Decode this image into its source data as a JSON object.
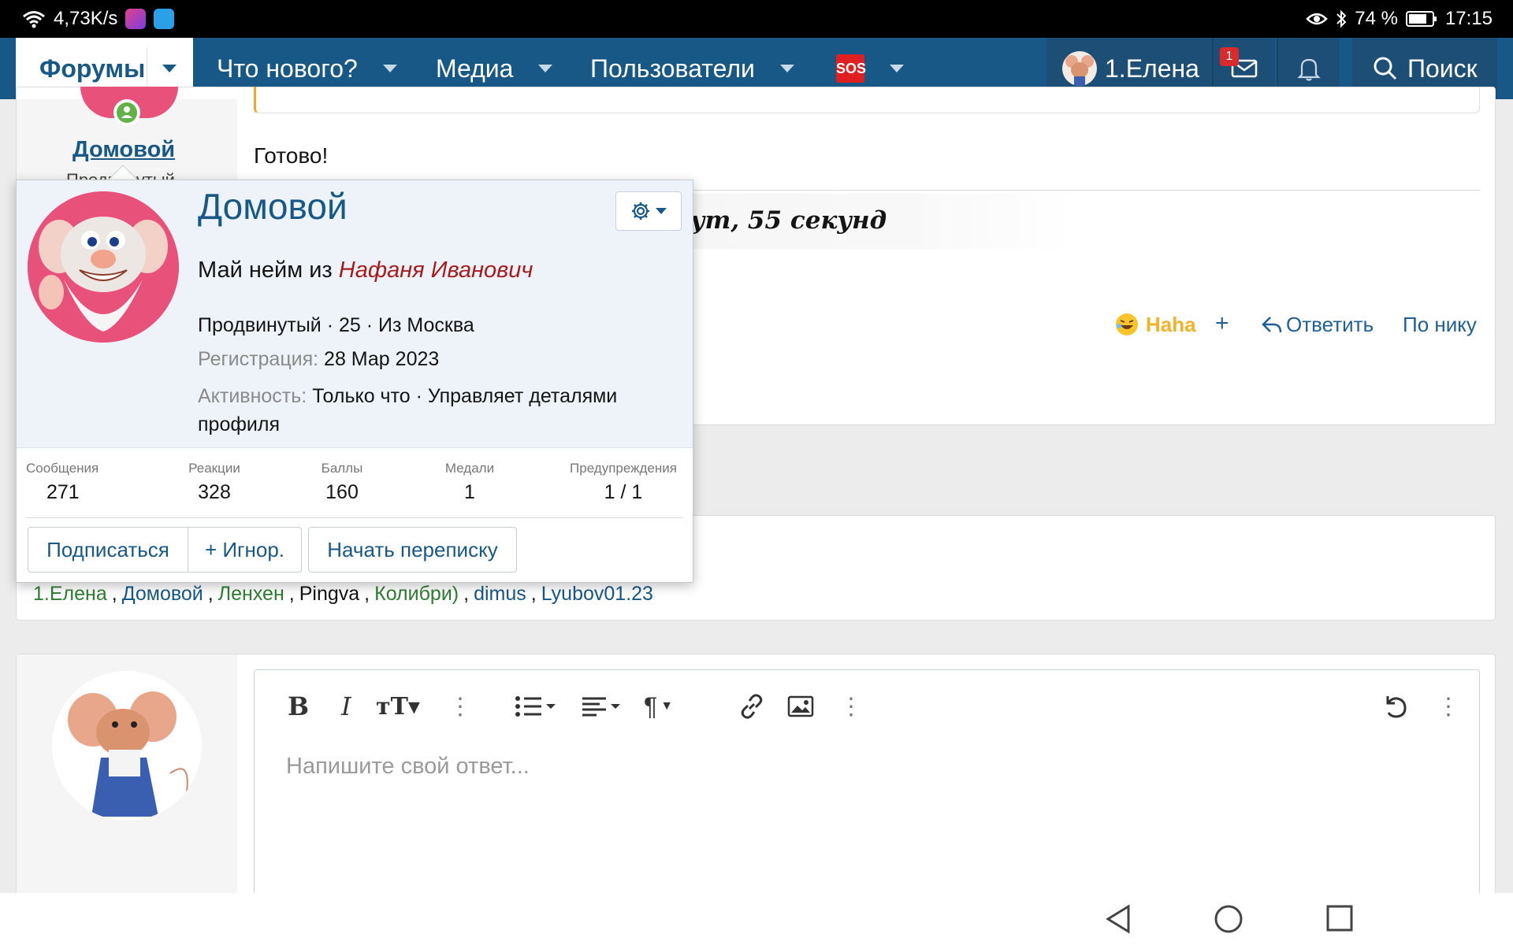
{
  "status_bar": {
    "speed": "4,73K/s",
    "battery": "74 %",
    "time": "17:15"
  },
  "nav": {
    "forums": "Форумы",
    "whats_new": "Что нового?",
    "media": "Медиа",
    "members": "Пользователи",
    "sos": "SOS",
    "user": "1.Елена",
    "mail_badge": "1",
    "search": "Поиск"
  },
  "post": {
    "author": "Домовой",
    "author_title_partial": "Продвинутый",
    "text": "Готово!",
    "signature_partial": "ут, 55 секунд",
    "reaction": "Haha",
    "plus": "+",
    "reply": "Ответить",
    "by_nick": "По нику"
  },
  "popup": {
    "name": "Домовой",
    "intro_prefix": "Май нейм из",
    "intro_name": "Нафаня Иванович",
    "meta": "Продвинутый · 25 · Из Москва",
    "reg_label": "Регистрация:",
    "reg_value": "28 Мар 2023",
    "activity_label": "Активность:",
    "activity_value": "Только что · Управляет деталями",
    "activity_value2": "профиля",
    "stats": [
      {
        "label": "Сообщения",
        "value": "271"
      },
      {
        "label": "Реакции",
        "value": "328"
      },
      {
        "label": "Баллы",
        "value": "160"
      },
      {
        "label": "Медали",
        "value": "1"
      },
      {
        "label": "Предупреждения",
        "value": "1 / 1"
      }
    ],
    "follow": "Подписаться",
    "ignore": "+ Игнор.",
    "conversation": "Начать переписку"
  },
  "online": {
    "users": [
      {
        "name": "1.Елена",
        "color": "#2e7d32"
      },
      {
        "name": "Домовой",
        "color": "#185886"
      },
      {
        "name": "Ленхен",
        "color": "#2e7d32"
      },
      {
        "name": "Pingva",
        "color": "#141414"
      },
      {
        "name": "Колибри)",
        "color": "#2e7d32"
      },
      {
        "name": "dimus",
        "color": "#185886"
      },
      {
        "name": "Lyubov01.23",
        "color": "#185886"
      }
    ]
  },
  "editor": {
    "placeholder": "Напишите свой ответ..."
  },
  "colors": {
    "nav_bg": "#185886",
    "link": "#185886",
    "popup_bg": "#edf3f9",
    "haha": "#f0b429",
    "intro_name": "#a61c1c"
  },
  "icons": [
    "wifi-icon",
    "eye-icon",
    "bluetooth-icon",
    "battery-icon",
    "mail-icon",
    "bell-icon",
    "search-icon",
    "gear-icon",
    "reply-icon",
    "bold-icon",
    "italic-icon",
    "text-size-icon",
    "more-icon",
    "list-icon",
    "align-icon",
    "paragraph-icon",
    "link-icon",
    "image-icon",
    "undo-icon",
    "back-icon",
    "home-icon",
    "recents-icon"
  ]
}
